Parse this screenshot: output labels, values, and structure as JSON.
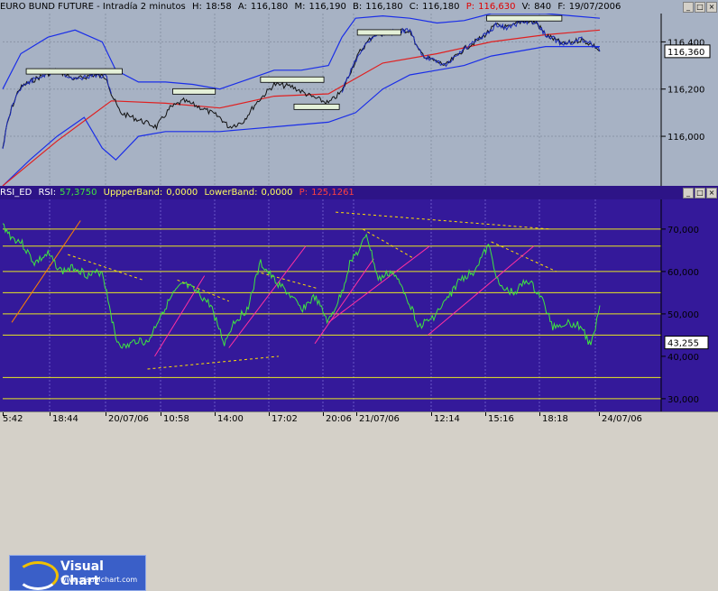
{
  "price_header": {
    "title": "EURO BUND FUTURE - Intradía 2 minutos",
    "h_label": "H:",
    "h_value": "18:58",
    "a_label": "A:",
    "a_value": "116,180",
    "m_label": "M:",
    "m_value": "116,190",
    "b_label": "B:",
    "b_value": "116,180",
    "c_label": "C:",
    "c_value": "116,180",
    "p_label": "P:",
    "p_value": "116,630",
    "v_label": "V:",
    "v_value": "840",
    "f_label": "F:",
    "f_value": "19/07/2006"
  },
  "rsi_header": {
    "name": "RSI_ED",
    "rsi_label": "RSI:",
    "rsi_value": "57,3750",
    "upper_label": "UppperBand:",
    "upper_value": "0,0000",
    "lower_label": "LowerBand:",
    "lower_value": "0,0000",
    "p_label": "P:",
    "p_value": "125,1261"
  },
  "colors": {
    "price_bg": "#a7b2c4",
    "price_line": "#000000",
    "ma": "#e02020",
    "bands": "#1a2ee8",
    "rsi_bg": "#34199a",
    "rsi_line": "#3ee640",
    "levels": "#e8e820",
    "support": "#ffe000",
    "trend_up": "#ff30a0",
    "trend_early": "#ff8000"
  },
  "price_last_value": "116,360",
  "rsi_last_value": "43,255",
  "logo": {
    "name": "Visual Chart",
    "url": "www.visualchart.com"
  },
  "chart_data": [
    {
      "type": "line",
      "title": "EURO BUND FUTURE - Intradía 2 minutos",
      "y_ticks": [
        "116,400",
        "116,200",
        "116,000"
      ],
      "y_tick_values": [
        116.4,
        116.2,
        116.0
      ],
      "ylim": [
        115.79,
        116.52
      ],
      "x_ticks": [
        "5:42",
        "18:44",
        "20/07/06",
        "10:58",
        "14:00",
        "17:02",
        "20:06",
        "21/07/06",
        "12:14",
        "15:16",
        "18:18",
        "24/07/06"
      ],
      "series": [
        {
          "role": "price",
          "x": [
            0,
            5,
            10,
            18,
            25,
            40,
            60,
            80,
            100,
            115,
            120,
            130,
            150,
            170,
            185,
            200,
            220,
            240,
            250,
            265,
            280,
            300,
            320,
            340,
            360,
            375,
            385,
            395,
            410,
            430,
            450,
            460,
            470,
            490,
            510,
            530,
            545,
            560,
            575,
            590,
            600,
            610,
            620,
            640,
            655,
            660
          ],
          "values": [
            115.95,
            116.05,
            116.12,
            116.2,
            116.22,
            116.25,
            116.28,
            116.24,
            116.26,
            116.25,
            116.18,
            116.1,
            116.07,
            116.04,
            116.12,
            116.15,
            116.12,
            116.08,
            116.04,
            116.06,
            116.14,
            116.22,
            116.21,
            116.17,
            116.14,
            116.19,
            116.28,
            116.36,
            116.43,
            116.44,
            116.45,
            116.36,
            116.33,
            116.3,
            116.37,
            116.42,
            116.47,
            116.46,
            116.49,
            116.48,
            116.43,
            116.41,
            116.39,
            116.41,
            116.38,
            116.36
          ]
        },
        {
          "role": "moving-average",
          "x": [
            0,
            60,
            120,
            180,
            240,
            300,
            360,
            420,
            480,
            540,
            600,
            660
          ],
          "values": [
            115.79,
            115.98,
            116.15,
            116.14,
            116.12,
            116.17,
            116.18,
            116.31,
            116.35,
            116.4,
            116.43,
            116.45
          ]
        },
        {
          "role": "upper-band",
          "x": [
            0,
            20,
            50,
            80,
            110,
            125,
            150,
            180,
            210,
            240,
            270,
            300,
            330,
            360,
            375,
            390,
            420,
            450,
            480,
            510,
            540,
            570,
            600,
            630,
            660
          ],
          "values": [
            116.2,
            116.35,
            116.42,
            116.45,
            116.4,
            116.28,
            116.23,
            116.23,
            116.22,
            116.2,
            116.24,
            116.28,
            116.28,
            116.3,
            116.42,
            116.5,
            116.51,
            116.5,
            116.48,
            116.49,
            116.52,
            116.52,
            116.52,
            116.51,
            116.5
          ]
        },
        {
          "role": "lower-band",
          "x": [
            0,
            30,
            60,
            90,
            110,
            125,
            150,
            180,
            210,
            240,
            270,
            300,
            330,
            360,
            390,
            420,
            450,
            480,
            510,
            540,
            570,
            600,
            630,
            660
          ],
          "values": [
            115.79,
            115.9,
            116.0,
            116.08,
            115.95,
            115.9,
            116.0,
            116.02,
            116.02,
            116.02,
            116.03,
            116.04,
            116.05,
            116.06,
            116.1,
            116.2,
            116.26,
            116.28,
            116.3,
            116.34,
            116.36,
            116.38,
            116.38,
            116.38
          ]
        }
      ],
      "annotations": [
        {
          "label": "top-box",
          "x": [
            26,
            132
          ],
          "y": 116.275
        },
        {
          "label": "top-box",
          "x": [
            188,
            235
          ],
          "y": 116.19
        },
        {
          "label": "top-box",
          "x": [
            285,
            355
          ],
          "y": 116.24
        },
        {
          "label": "bottom-box",
          "x": [
            322,
            372
          ],
          "y": 116.125
        },
        {
          "label": "top-box",
          "x": [
            392,
            440
          ],
          "y": 116.44
        },
        {
          "label": "top-box",
          "x": [
            535,
            618
          ],
          "y": 116.5
        }
      ]
    },
    {
      "type": "line",
      "title": "RSI_ED",
      "y_ticks": [
        "70,000",
        "60,000",
        "50,000",
        "40,000",
        "30,000"
      ],
      "y_tick_values": [
        70,
        60,
        50,
        40,
        30
      ],
      "ylim": [
        27,
        77
      ],
      "levels": [
        70,
        66,
        60,
        55,
        50,
        45,
        35,
        30
      ],
      "series": [
        {
          "role": "rsi",
          "x": [
            0,
            10,
            20,
            35,
            50,
            65,
            80,
            95,
            110,
            118,
            125,
            135,
            150,
            160,
            175,
            190,
            200,
            215,
            230,
            245,
            255,
            270,
            285,
            300,
            315,
            330,
            345,
            360,
            375,
            385,
            395,
            402,
            415,
            430,
            445,
            460,
            475,
            490,
            505,
            520,
            537,
            550,
            565,
            580,
            595,
            608,
            625,
            640,
            650,
            655,
            660
          ],
          "values": [
            71,
            68,
            67,
            62,
            64,
            60,
            61,
            59,
            60,
            52,
            44,
            42,
            44,
            43,
            50,
            55,
            57,
            55,
            52,
            43,
            48,
            51,
            62,
            58,
            55,
            51,
            54,
            48,
            55,
            63,
            65,
            69,
            58,
            60,
            55,
            47,
            49,
            53,
            58,
            60,
            66,
            56,
            55,
            58,
            54,
            47,
            48,
            47,
            42,
            47,
            52
          ]
        }
      ],
      "annotations": [
        {
          "label": "resistance",
          "x": [
            72,
            155
          ],
          "y": [
            64,
            58
          ]
        },
        {
          "label": "support",
          "x": [
            160,
            305
          ],
          "y": [
            37,
            40
          ]
        },
        {
          "label": "resistance",
          "x": [
            193,
            250
          ],
          "y": [
            58,
            53
          ]
        },
        {
          "label": "resistance",
          "x": [
            280,
            348
          ],
          "y": [
            60,
            56
          ]
        },
        {
          "label": "resistance",
          "x": [
            368,
            605
          ],
          "y": [
            74,
            70
          ]
        },
        {
          "label": "resistance",
          "x": [
            398,
            455
          ],
          "y": [
            70,
            63
          ]
        },
        {
          "label": "resistance",
          "x": [
            540,
            612
          ],
          "y": [
            67,
            60
          ]
        },
        {
          "label": "uptrend",
          "x": [
            10,
            86
          ],
          "y": [
            48,
            72
          ]
        },
        {
          "label": "uptrend",
          "x": [
            168,
            223
          ],
          "y": [
            40,
            59
          ]
        },
        {
          "label": "uptrend",
          "x": [
            250,
            335
          ],
          "y": [
            42,
            66
          ]
        },
        {
          "label": "uptrend",
          "x": [
            345,
            410
          ],
          "y": [
            43,
            63
          ]
        },
        {
          "label": "uptrend",
          "x": [
            360,
            472
          ],
          "y": [
            48,
            66
          ]
        },
        {
          "label": "uptrend",
          "x": [
            470,
            587
          ],
          "y": [
            45,
            66
          ]
        }
      ]
    }
  ]
}
